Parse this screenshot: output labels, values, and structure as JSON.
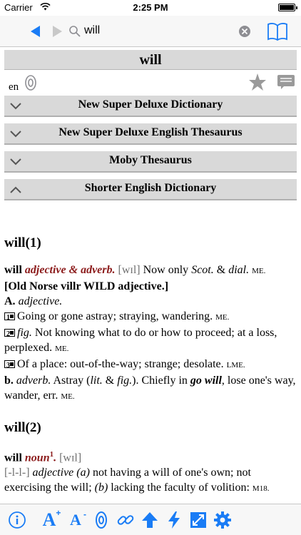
{
  "status": {
    "carrier": "Carrier",
    "time": "2:25 PM"
  },
  "search": {
    "query": "will"
  },
  "word": "will",
  "lang": "en",
  "dictionaries": [
    {
      "label": "New Super Deluxe Dictionary",
      "expanded": false
    },
    {
      "label": "New Super Deluxe English Thesaurus",
      "expanded": false
    },
    {
      "label": "Moby Thesaurus",
      "expanded": false
    },
    {
      "label": "Shorter English Dictionary",
      "expanded": true
    }
  ],
  "entries": [
    {
      "title": "will(1)",
      "headword": "will",
      "pos": "adjective & adverb.",
      "pron": "[wɪl]",
      "note_a": "Now only",
      "note_b": "Scot.",
      "note_c": "&",
      "note_d": "dial.",
      "era": "ME.",
      "etym": "[Old Norse villr WILD adjective.]",
      "a_label": "A.",
      "a_pos": "adjective.",
      "s1_num": "1",
      "s1_text": "Going or gone astray; straying, wandering.",
      "s1_era": "ME.",
      "s2_num": "2",
      "s2_fig": "fig.",
      "s2_text": "Not knowing what to do or how to proceed; at a loss, perplexed.",
      "s2_era": "ME.",
      "s3_num": "3",
      "s3_text": "Of a place: out-of-the-way; strange; desolate.",
      "s3_era": "LME.",
      "b_label": "b.",
      "b_pos": "adverb.",
      "b_text1": "Astray (",
      "b_lit": "lit.",
      "b_amp": "&",
      "b_fig": "fig.",
      "b_text2": "). Chiefly in",
      "b_phrase": "go will",
      "b_text3": ", lose one's way, wander, err.",
      "b_era": "ME."
    },
    {
      "title": "will(2)",
      "headword": "will",
      "pos": "noun",
      "sup": "1",
      "pron": "[wɪl]",
      "stress": "[-l-l-]",
      "adj": "adjective",
      "a": "(a)",
      "text1": "not having a will of one's own; not exercising the will;",
      "b": "(b)",
      "text2": "lacking the faculty of volition:",
      "era": "M18."
    }
  ],
  "toolbar": {
    "items": [
      "info-icon",
      "font-increase-icon",
      "font-decrease-icon",
      "audio-icon",
      "link-icon",
      "arrow-up-icon",
      "lightning-icon",
      "expand-icon",
      "gear-icon"
    ],
    "font_letter": "A",
    "plus": "+",
    "minus": "-"
  },
  "colors": {
    "accent": "#1a7cf5",
    "pos_red": "#8b1a1a",
    "bar_gray": "#d9d9d9"
  }
}
